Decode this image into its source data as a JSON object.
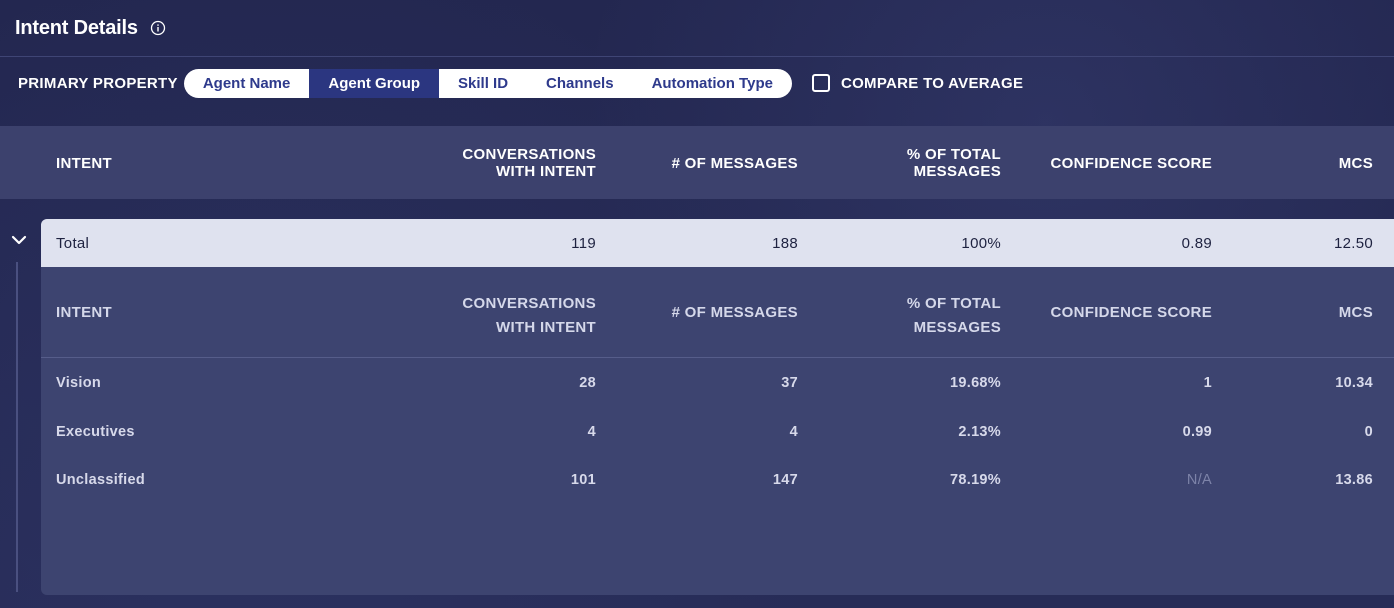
{
  "header": {
    "title": "Intent Details",
    "info_icon": "info-circle-icon"
  },
  "filters": {
    "label": "PRIMARY PROPERTY",
    "options": [
      "Agent Name",
      "Agent Group",
      "Skill ID",
      "Channels",
      "Automation Type"
    ],
    "selected": "Agent Group",
    "compare_label": "COMPARE TO AVERAGE",
    "compare_checked": false
  },
  "table": {
    "columns": {
      "intent": "INTENT",
      "conv_line1": "CONVERSATIONS",
      "conv_line2": "WITH INTENT",
      "messages": "# OF MESSAGES",
      "pct_line1": "% OF TOTAL",
      "pct_line2": "MESSAGES",
      "confidence": "CONFIDENCE SCORE",
      "mcs": "MCS"
    },
    "total": {
      "label": "Total",
      "conversations": "119",
      "messages": "188",
      "pct": "100%",
      "confidence": "0.89",
      "mcs": "12.50"
    },
    "rows": [
      {
        "intent": "Vision",
        "conversations": "28",
        "messages": "37",
        "pct": "19.68%",
        "confidence": "1",
        "mcs": "10.34"
      },
      {
        "intent": "Executives",
        "conversations": "4",
        "messages": "4",
        "pct": "2.13%",
        "confidence": "0.99",
        "mcs": "0"
      },
      {
        "intent": "Unclassified",
        "conversations": "101",
        "messages": "147",
        "pct": "78.19%",
        "confidence": "N/A",
        "mcs": "13.86"
      }
    ]
  },
  "colors": {
    "background": "#24284f",
    "header_band": "#3c416d",
    "panel": "#3d4470",
    "total_row": "#dfe2ef",
    "active_pill": "#2b3680",
    "pill_text": "#2e3a8c"
  }
}
